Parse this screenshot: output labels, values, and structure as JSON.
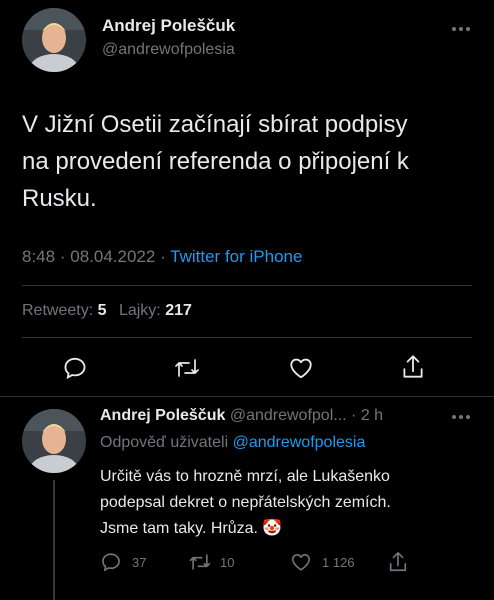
{
  "main_tweet": {
    "author_name": "Andrej Poleščuk",
    "author_handle": "@andrewofpolesia",
    "text_line1": "V Jižní Osetii začínají sbírat podpisy",
    "text_line2": "na provedení referenda o připojení k",
    "text_line3": "Rusku.",
    "time": "8:48",
    "sep": "·",
    "date": "08.04.2022",
    "sep2": "·",
    "source": "Twitter for iPhone",
    "retweets_label": "Retweety:",
    "retweets_count": "5",
    "likes_label": "Lajky:",
    "likes_count": "217",
    "more_icon": "more-horizontal-icon"
  },
  "actions": {
    "reply_icon": "reply-icon",
    "retweet_icon": "retweet-icon",
    "like_icon": "heart-icon",
    "share_icon": "share-icon"
  },
  "reply": {
    "author_name": "Andrej Poleščuk",
    "author_handle": "@andrewofpol...",
    "sep": "·",
    "time_ago": "2 h",
    "replying_label": "Odpověď uživateli",
    "replying_to": "@andrewofpolesia",
    "line1": "Určitě vás to hrozně mrzí, ale Lukašenko",
    "line2": "podepsal dekret o nepřátelských zemích.",
    "line3": "Jsme tam taky. Hrůza.",
    "emoji": "🤡",
    "reply_count": "37",
    "retweet_count": "10",
    "like_count": "1 126"
  },
  "colors": {
    "background": "#000000",
    "text": "#e7e9ea",
    "muted": "#71767b",
    "link": "#1d9bf0",
    "divider": "#2f3336"
  }
}
